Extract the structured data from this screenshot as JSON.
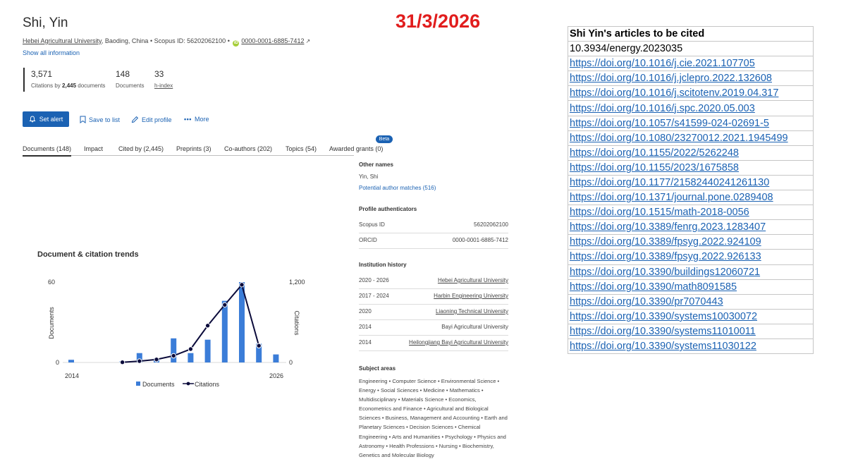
{
  "author": {
    "name": "Shi, Yin",
    "affiliation": "Hebei Agricultural University",
    "location": ", Baoding, China",
    "scopus_id_label": "Scopus ID: 56202062100",
    "orcid": "0000-0001-6885-7412",
    "show_all": "Show all information"
  },
  "date_stamp": "31/3/2026",
  "metrics": [
    {
      "value": "3,571",
      "label_prefix": "Citations by ",
      "label_bold": "2,445",
      "label_suffix": " documents"
    },
    {
      "value": "148",
      "label": "Documents"
    },
    {
      "value": "33",
      "label": "h-index"
    }
  ],
  "actions": {
    "set_alert": "Set alert",
    "save_to_list": "Save to list",
    "edit_profile": "Edit profile",
    "more": "More"
  },
  "tabs": [
    "Documents (148)",
    "Impact",
    "Cited by (2,445)",
    "Preprints (3)",
    "Co-authors (202)",
    "Topics (54)",
    "Awarded grants (0)"
  ],
  "beta_badge": "Beta",
  "info_panel": {
    "other_names_title": "Other names",
    "other_name": "Yin, Shi",
    "potential_matches": "Potential author matches (516)",
    "authenticators_title": "Profile authenticators",
    "authenticators": [
      {
        "key": "Scopus ID",
        "value": "56202062100"
      },
      {
        "key": "ORCID",
        "value": "0000-0001-6885-7412"
      }
    ],
    "institution_title": "Institution history",
    "institutions": [
      {
        "years": "2020 - 2026",
        "name": "Hebei Agricultural University",
        "linked": true
      },
      {
        "years": "2017 - 2024",
        "name": "Harbin Engineering University",
        "linked": true
      },
      {
        "years": "2020",
        "name": "Liaoning Technical University",
        "linked": true
      },
      {
        "years": "2014",
        "name": "Bayi Agricultural University",
        "linked": false
      },
      {
        "years": "2014",
        "name": "Heilongjiang Bayi Agricultural University",
        "linked": true
      }
    ],
    "subject_title": "Subject areas",
    "subject_areas": "Engineering • Computer Science • Environmental Science • Energy • Social Sciences • Medicine • Mathematics • Multidisciplinary • Materials Science • Economics, Econometrics and Finance • Agricultural and Biological Sciences • Business, Management and Accounting • Earth and Planetary Sciences • Decision Sciences • Chemical Engineering • Arts and Humanities • Psychology • Physics and Astronomy • Health Professions • Nursing • Biochemistry, Genetics and Molecular Biology"
  },
  "chart_data": {
    "type": "bar+line",
    "title": "Document & citation trends",
    "x": [
      2014,
      2015,
      2016,
      2017,
      2018,
      2019,
      2020,
      2021,
      2022,
      2023,
      2024,
      2025,
      2026
    ],
    "x_tick_labels": [
      "2014",
      "2026"
    ],
    "series": [
      {
        "name": "Documents",
        "axis": "left",
        "kind": "bar",
        "color": "#3b7dd8",
        "values": [
          2,
          0,
          0,
          1,
          7,
          3,
          18,
          7,
          17,
          46,
          60,
          14,
          6
        ]
      },
      {
        "name": "Citations",
        "axis": "right",
        "kind": "line",
        "color": "#0b0b3b",
        "values": [
          null,
          null,
          null,
          3,
          20,
          45,
          100,
          200,
          550,
          860,
          1160,
          250,
          null
        ]
      }
    ],
    "ylabel_left": "Documents",
    "ylim_left": [
      0,
      60
    ],
    "yticks_left": [
      "0",
      "60"
    ],
    "ylabel_right": "Citations",
    "ylim_right": [
      0,
      1200
    ],
    "yticks_right": [
      "0",
      "1,200"
    ],
    "legend_position": "bottom"
  },
  "doi_table": {
    "header": "Shi Yin's articles to be cited",
    "first_plain": "10.3934/energy.2023035",
    "links": [
      "https://doi.org/10.1016/j.cie.2021.107705",
      "https://doi.org/10.1016/j.jclepro.2022.132608",
      "https://doi.org/10.1016/j.scitotenv.2019.04.317",
      "https://doi.org/10.1016/j.spc.2020.05.003",
      "https://doi.org/10.1057/s41599-024-02691-5",
      "https://doi.org/10.1080/23270012.2021.1945499",
      "https://doi.org/10.1155/2022/5262248",
      "https://doi.org/10.1155/2023/1675858",
      "https://doi.org/10.1177/21582440241261130",
      "https://doi.org/10.1371/journal.pone.0289408",
      "https://doi.org/10.1515/math-2018-0056",
      "https://doi.org/10.3389/fenrg.2023.1283407",
      "https://doi.org/10.3389/fpsyg.2022.924109",
      "https://doi.org/10.3389/fpsyg.2022.926133",
      "https://doi.org/10.3390/buildings12060721",
      "https://doi.org/10.3390/math8091585",
      "https://doi.org/10.3390/pr7070443",
      "https://doi.org/10.3390/systems10030072",
      "https://doi.org/10.3390/systems11010011",
      "https://doi.org/10.3390/systems11030122"
    ]
  },
  "icons": {
    "alert": "bell-icon",
    "save": "bookmark-icon",
    "edit": "pencil-icon",
    "more": "ellipsis-icon",
    "external": "external-link-icon"
  }
}
